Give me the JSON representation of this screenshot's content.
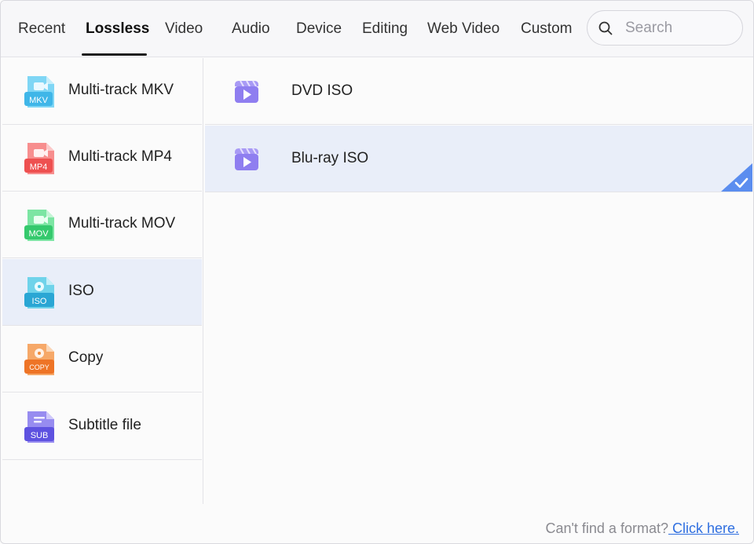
{
  "tabs": [
    {
      "label": "Recent"
    },
    {
      "label": "Lossless",
      "active": true
    },
    {
      "label": "Video"
    },
    {
      "label": "Audio"
    },
    {
      "label": "Device"
    },
    {
      "label": "Editing"
    },
    {
      "label": "Web Video"
    },
    {
      "label": "Custom"
    }
  ],
  "search": {
    "placeholder": "Search",
    "value": ""
  },
  "categories": [
    {
      "label": "Multi-track MKV",
      "icon": "mkv-file-icon",
      "badge": "MKV",
      "color": "#4cc3f0"
    },
    {
      "label": "Multi-track MP4",
      "icon": "mp4-file-icon",
      "badge": "MP4",
      "color": "#f05a5a"
    },
    {
      "label": "Multi-track MOV",
      "icon": "mov-file-icon",
      "badge": "MOV",
      "color": "#3fd17a"
    },
    {
      "label": "ISO",
      "icon": "iso-file-icon",
      "badge": "ISO",
      "color": "#2fb8d8",
      "selected": true
    },
    {
      "label": "Copy",
      "icon": "copy-file-icon",
      "badge": "COPY",
      "color": "#f07a2a"
    },
    {
      "label": "Subtitle file",
      "icon": "subtitle-file-icon",
      "badge": "SUB",
      "color": "#6a5ee8"
    }
  ],
  "formats": [
    {
      "label": "DVD ISO",
      "icon": "video-clapper-icon"
    },
    {
      "label": "Blu-ray ISO",
      "icon": "video-clapper-icon",
      "selected": true
    }
  ],
  "footer": {
    "question": "Can't find a format?",
    "link": " Click here."
  },
  "colors": {
    "accent": "#5b8def",
    "selected_bg": "#e9eef9",
    "link": "#2f6fe0",
    "format_icon": "#8f7ef0"
  }
}
